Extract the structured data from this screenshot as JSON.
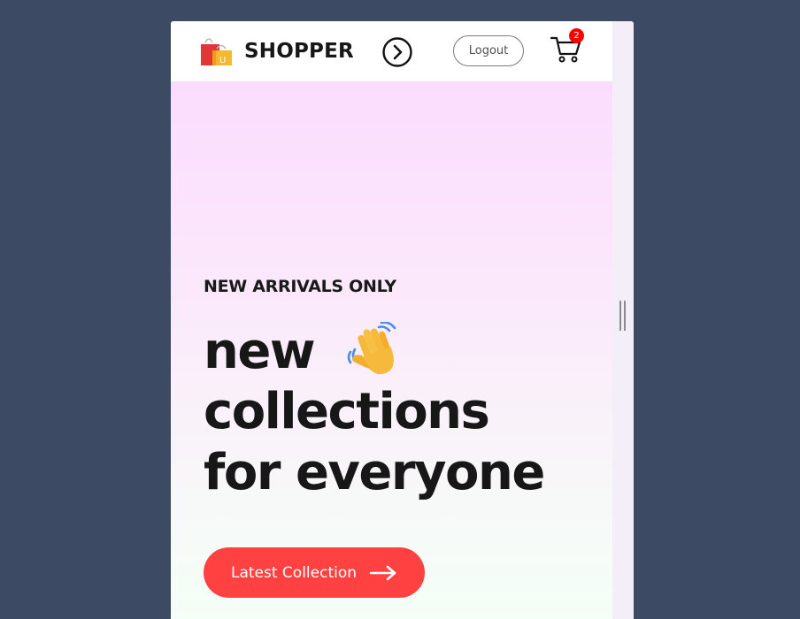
{
  "navbar": {
    "brand_name": "SHOPPER",
    "logo_icon": "shopping-bags-logo",
    "menu_toggle_icon": "chevron-right-circle-icon",
    "logout_label": "Logout",
    "cart_icon": "cart-icon",
    "cart_count": "2"
  },
  "hero": {
    "eyebrow": "NEW ARRIVALS ONLY",
    "title_line_1": "new",
    "title_icon": "waving-hand-icon",
    "title_line_2": "collections",
    "title_line_3": "for everyone",
    "cta_label": "Latest Collection",
    "cta_icon": "arrow-right-icon"
  },
  "colors": {
    "accent": "#ff4141",
    "badge": "#ff0000",
    "page_background": "#3d4a63",
    "text": "#171717"
  }
}
